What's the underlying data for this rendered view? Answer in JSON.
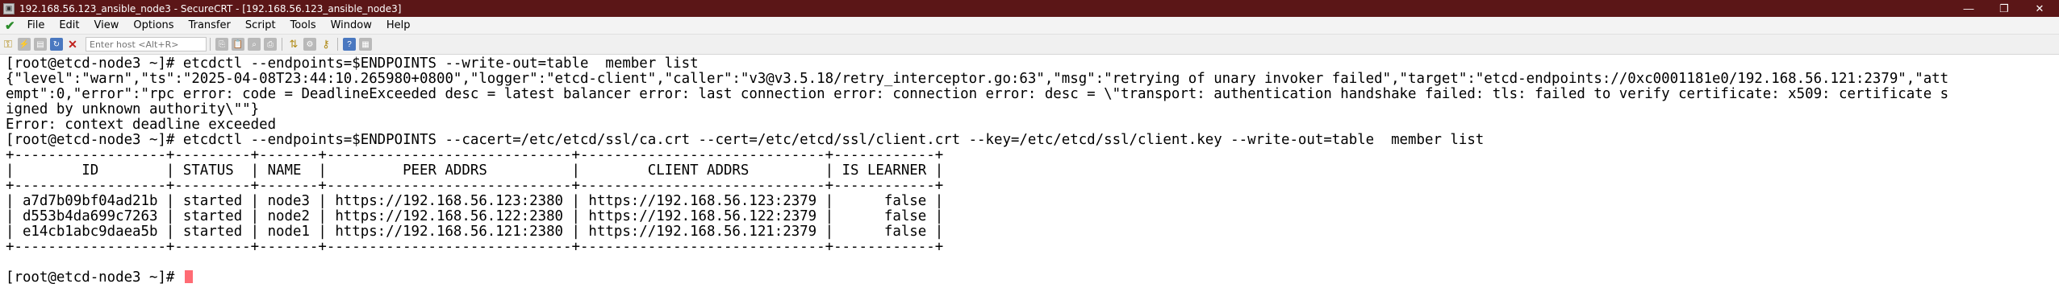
{
  "window": {
    "title": "192.168.56.123_ansible_node3 - SecureCRT - [192.168.56.123_ansible_node3]",
    "controls": {
      "minimize": "—",
      "maximize": "❐",
      "close": "✕"
    }
  },
  "menubar": {
    "items": [
      "File",
      "Edit",
      "View",
      "Options",
      "Transfer",
      "Script",
      "Tools",
      "Window",
      "Help"
    ]
  },
  "toolbar": {
    "host_placeholder": "Enter host <Alt+R>",
    "icons": [
      "connect-icon",
      "quick-connect-icon",
      "connect-tab-icon",
      "reconnect-icon",
      "disconnect-icon",
      "copy-icon",
      "paste-icon",
      "find-icon",
      "print-icon",
      "sftp-icon",
      "settings-icon",
      "keymap-icon",
      "help-icon",
      "about-icon"
    ]
  },
  "terminal": {
    "lines": [
      "[root@etcd-node3 ~]# etcdctl --endpoints=$ENDPOINTS --write-out=table  member list",
      "{\"level\":\"warn\",\"ts\":\"2025-04-08T23:44:10.265980+0800\",\"logger\":\"etcd-client\",\"caller\":\"v3@v3.5.18/retry_interceptor.go:63\",\"msg\":\"retrying of unary invoker failed\",\"target\":\"etcd-endpoints://0xc0001181e0/192.168.56.121:2379\",\"att",
      "empt\":0,\"error\":\"rpc error: code = DeadlineExceeded desc = latest balancer error: last connection error: connection error: desc = \\\"transport: authentication handshake failed: tls: failed to verify certificate: x509: certificate s",
      "igned by unknown authority\\\"\"}",
      "Error: context deadline exceeded",
      "[root@etcd-node3 ~]# etcdctl --endpoints=$ENDPOINTS --cacert=/etc/etcd/ssl/ca.crt --cert=/etc/etcd/ssl/client.crt --key=/etc/etcd/ssl/client.key --write-out=table  member list",
      "+------------------+---------+-------+-----------------------------+-----------------------------+------------+",
      "|        ID        | STATUS  | NAME  |         PEER ADDRS          |        CLIENT ADDRS         | IS LEARNER |",
      "+------------------+---------+-------+-----------------------------+-----------------------------+------------+",
      "| a7d7b09bf04ad21b | started | node3 | https://192.168.56.123:2380 | https://192.168.56.123:2379 |      false |",
      "| d553b4da699c7263 | started | node2 | https://192.168.56.122:2380 | https://192.168.56.122:2379 |      false |",
      "| e14cb1abc9daea5b | started | node1 | https://192.168.56.121:2380 | https://192.168.56.121:2379 |      false |",
      "+------------------+---------+-------+-----------------------------+-----------------------------+------------+",
      "",
      "[root@etcd-node3 ~]# "
    ],
    "cursor_color": "#ff6b74"
  },
  "colors": {
    "titlebar": "#5b1617",
    "terminal_bg": "#ffffff",
    "terminal_fg": "#000000"
  }
}
